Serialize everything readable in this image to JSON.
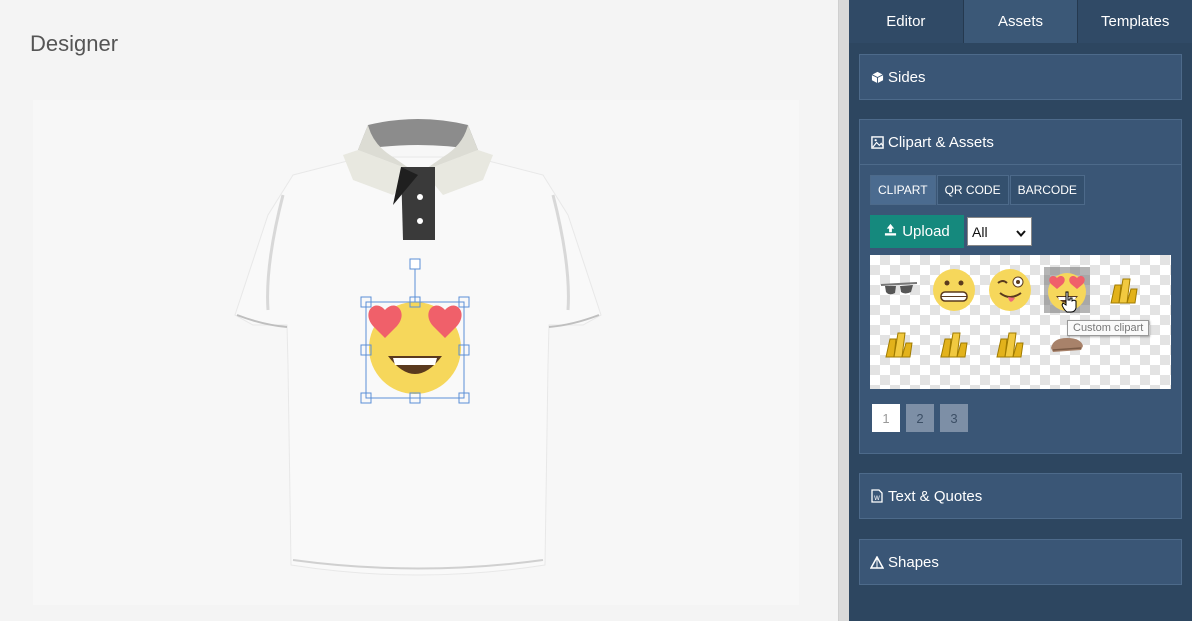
{
  "stage": {
    "title": "Designer"
  },
  "panel": {
    "tabs": [
      {
        "label": "Editor"
      },
      {
        "label": "Assets"
      },
      {
        "label": "Templates"
      }
    ],
    "sections": {
      "sides": {
        "label": "Sides",
        "icon": "cube-icon"
      },
      "clipart": {
        "label": "Clipart & Assets",
        "icon": "image-icon"
      },
      "text": {
        "label": "Text & Quotes",
        "icon": "word-doc-icon"
      },
      "shapes": {
        "label": "Shapes",
        "icon": "triangle-icon"
      }
    },
    "clipart": {
      "subtabs": [
        {
          "label": "CLIPART"
        },
        {
          "label": "QR CODE"
        },
        {
          "label": "BARCODE"
        }
      ],
      "upload_label": "Upload",
      "filter_value": "All",
      "tooltip": "Custom clipart",
      "items": [
        {
          "name": "sunglasses-clipart"
        },
        {
          "name": "grimacing-face-clipart"
        },
        {
          "name": "winking-tongue-face-clipart"
        },
        {
          "name": "heart-eyes-face-clipart"
        },
        {
          "name": "golden-bars-clipart"
        },
        {
          "name": "golden-bars-clipart"
        },
        {
          "name": "golden-bars-clipart"
        },
        {
          "name": "golden-bars-clipart"
        },
        {
          "name": "bread-clipart"
        }
      ],
      "pages": [
        "1",
        "2",
        "3"
      ]
    }
  },
  "colors": {
    "panel_bg": "#2d4660",
    "section_bg": "#3a5676",
    "upload_button": "#15897d",
    "selection_handles": "#5b8fd6"
  }
}
